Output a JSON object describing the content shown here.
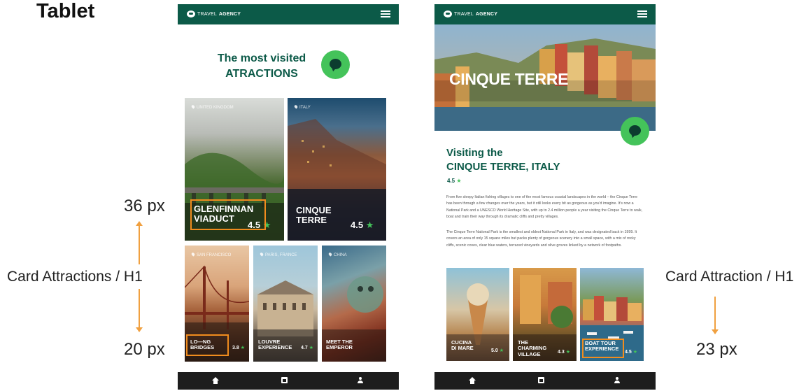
{
  "page": {
    "title": "Tablet"
  },
  "annotations": {
    "left_label": "Card Attractions / H1",
    "left_top_px": "36 px",
    "left_bottom_px": "20 px",
    "right_label": "Card Attraction / H1",
    "right_bottom_px": "23 px"
  },
  "brand": {
    "logo_light": "TRAVEL",
    "logo_bold": "AGENCY"
  },
  "colors": {
    "brand_green": "#0c5a48",
    "accent_green": "#44c35a",
    "highlight_orange": "#f08c1e"
  },
  "screen_list": {
    "heading_line1": "The most visited",
    "heading_line2": "ATRACTIONS",
    "cards": [
      {
        "location": "UNITED KINGDOM",
        "name": "GLENFINNAN\nVIADUCT",
        "rating": "4.5"
      },
      {
        "location": "ITALY",
        "name": "CINQUE\nTERRE",
        "rating": "4.5"
      },
      {
        "location": "SAN FRANCISCO",
        "name": "LO—NG\nBRIDGES",
        "rating": "3.8"
      },
      {
        "location": "PARIS, FRANCE",
        "name": "LOUVRE\nEXPERIENCE",
        "rating": "4.7"
      },
      {
        "location": "CHINA",
        "name": "MEET THE\nEMPEROR",
        "rating": ""
      }
    ]
  },
  "screen_detail": {
    "hero_title": "CINQUE TERRE",
    "heading_line1": "Visiting the",
    "heading_line2": "CINQUE TERRE, ITALY",
    "rating": "4.5",
    "paragraph1": "From five sleepy Italian fishing villages to one of the most famous coastal landscapes in the world – the Cinque Terre has been through a few changes over the years, but it still looks every bit as gorgeous as you'd imagine. It's now a National Park and a UNESCO World Heritage Site, with up to 2.4 million people a year visiting the Cinque Terre to walk, boat and train their way through its dramatic cliffs and pretty villages.",
    "paragraph2": "The Cinque Terre National Park is the smallest and oldest National Park in Italy, and was designated back in 1999. It covers an area of only 15 square miles but packs plenty of gorgeous scenery into a small space, with a mix of rocky cliffs, scenic coves, clear blue waters, terraced vineyards and olive groves linked by a network of footpaths.",
    "cards": [
      {
        "name": "CUCINA\nDI MARE",
        "rating": "5.0"
      },
      {
        "name": "THE\nCHARMING\nVILLAGE",
        "rating": "4.3"
      },
      {
        "name": "BOAT TOUR\nEXPERIENCE",
        "rating": "4.5"
      }
    ]
  },
  "icons": {
    "logo": "travel-agency-logo-icon",
    "menu": "hamburger-menu-icon",
    "chat": "chat-bubble-icon",
    "location": "location-pin-icon",
    "star": "star-icon",
    "nav_home": "home-icon",
    "nav_calendar": "calendar-icon",
    "nav_profile": "user-icon"
  }
}
